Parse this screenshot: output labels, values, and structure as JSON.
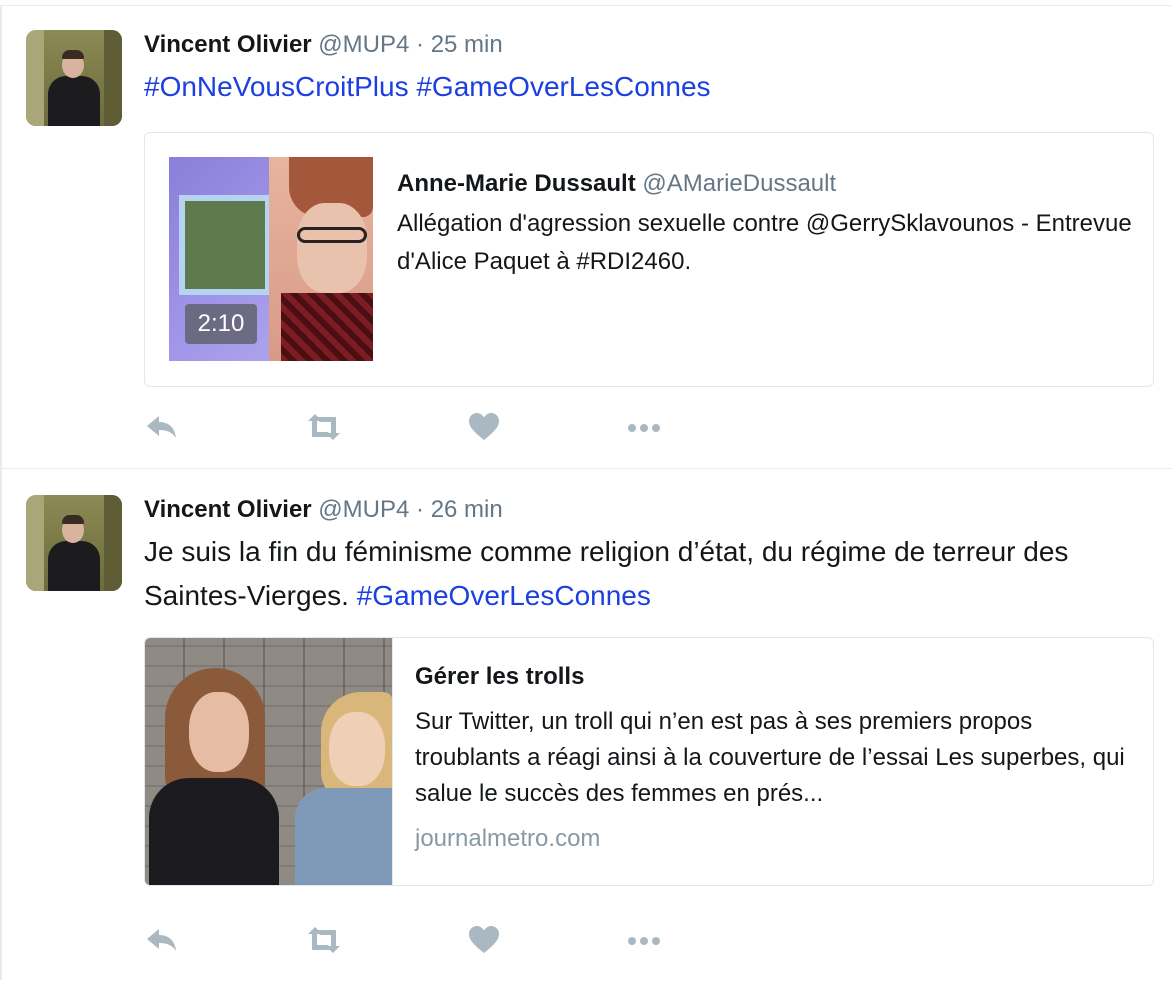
{
  "colors": {
    "hashtag": "#1b3fe0",
    "meta": "#657786",
    "action_icon": "#aab8c2",
    "border": "#e1e8ed"
  },
  "tweets": [
    {
      "author_name": "Vincent Olivier",
      "author_handle": "@MUP4",
      "separator": "·",
      "timestamp": "25 min",
      "text_parts": [
        {
          "text": "#OnNeVousCroitPlus",
          "type": "hashtag"
        },
        {
          "text": " ",
          "type": "text"
        },
        {
          "text": "#GameOverLesConnes",
          "type": "hashtag"
        }
      ],
      "quoted_tweet": {
        "author_name": "Anne-Marie Dussault",
        "author_handle": "@AMarieDussault",
        "text": "Allégation d'agression sexuelle contre @GerrySklavounos - Entrevue d'Alice Paquet à #RDI2460.",
        "video_duration": "2:10"
      },
      "action_icons": [
        "reply-icon",
        "retweet-icon",
        "like-icon",
        "more-icon"
      ]
    },
    {
      "author_name": "Vincent Olivier",
      "author_handle": "@MUP4",
      "separator": "·",
      "timestamp": "26 min",
      "text_parts": [
        {
          "text": "Je suis la fin du féminisme comme religion d’état, du régime de terreur des Saintes-Vierges. ",
          "type": "text"
        },
        {
          "text": "#GameOverLesConnes",
          "type": "hashtag"
        }
      ],
      "link_card": {
        "title": "Gérer les trolls",
        "description": "Sur Twitter, un troll qui n’en est pas à ses premiers propos troublants a réagi ainsi à la couverture de l’essai Les superbes, qui salue le succès des femmes en prés...",
        "domain": "journalmetro.com"
      },
      "action_icons": [
        "reply-icon",
        "retweet-icon",
        "like-icon",
        "more-icon"
      ]
    }
  ]
}
